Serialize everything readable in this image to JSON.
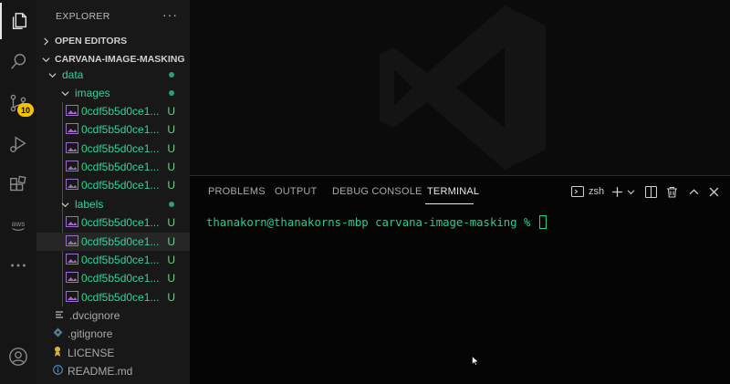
{
  "activity_bar": {
    "scm_badge": "10",
    "items": [
      "files-icon",
      "search-icon",
      "source-control-icon",
      "run-debug-icon",
      "extensions-icon",
      "aws-icon",
      "more-icon",
      "account-icon"
    ]
  },
  "sidebar": {
    "title": "EXPLORER",
    "more": "···",
    "open_editors": "OPEN EDITORS",
    "project": "CARVANA-IMAGE-MASKING",
    "tree": {
      "data_folder": "data",
      "images_folder": "images",
      "images_files": [
        "0cdf5b5d0ce1...",
        "0cdf5b5d0ce1...",
        "0cdf5b5d0ce1...",
        "0cdf5b5d0ce1...",
        "0cdf5b5d0ce1..."
      ],
      "labels_folder": "labels",
      "labels_files": [
        "0cdf5b5d0ce1...",
        "0cdf5b5d0ce1...",
        "0cdf5b5d0ce1...",
        "0cdf5b5d0ce1...",
        "0cdf5b5d0ce1..."
      ],
      "untracked_status": "U",
      "root_files": [
        ".dvcignore",
        ".gitignore",
        "LICENSE",
        "README.md"
      ]
    }
  },
  "panel": {
    "tabs": [
      "PROBLEMS",
      "OUTPUT",
      "DEBUG CONSOLE",
      "TERMINAL"
    ],
    "active_tab": "TERMINAL",
    "shell": "zsh",
    "terminal_prompt": "thanakorn@thanakorns-mbp carvana-image-masking % "
  },
  "colors": {
    "accent_green": "#23d18b",
    "badge": "#f5c400",
    "untracked": "#73c991"
  }
}
